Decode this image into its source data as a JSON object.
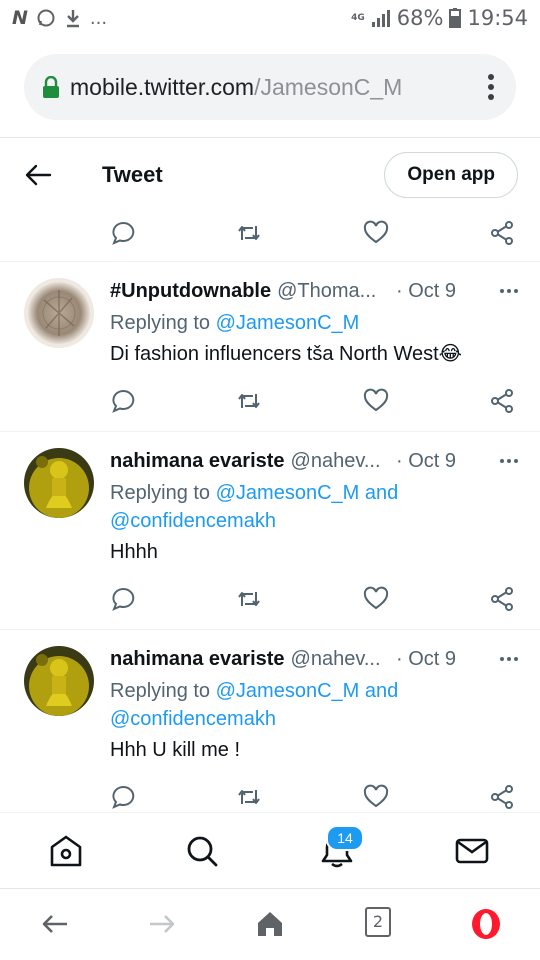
{
  "status_bar": {
    "network": "4G",
    "battery": "68%",
    "time": "19:54",
    "ellipsis": "..."
  },
  "browser": {
    "url_domain": "mobile.twitter.com",
    "url_path": "/JamesonC_M"
  },
  "header": {
    "title": "Tweet",
    "open_app": "Open app"
  },
  "tweets": [
    {
      "name": "#Unputdownable",
      "handle": "@Thoma...",
      "date": "· Oct 9",
      "replying_prefix": "Replying to",
      "replying_to": "@JamesonC_M",
      "replying_and": "",
      "replying_to_2": "",
      "text": "Di fashion influencers tša North West",
      "emoji": "😂"
    },
    {
      "name": "nahimana evariste",
      "handle": "@nahev...",
      "date": "· Oct 9",
      "replying_prefix": "Replying to",
      "replying_to": "@JamesonC_M",
      "replying_and": "and",
      "replying_to_2": "@confidencemakh",
      "text": "Hhhh"
    },
    {
      "name": "nahimana evariste",
      "handle": "@nahev...",
      "date": "· Oct 9",
      "replying_prefix": "Replying to",
      "replying_to": "@JamesonC_M",
      "replying_and": "and",
      "replying_to_2": "@confidencemakh",
      "text": "Hhh U kill me !"
    }
  ],
  "bottom_nav": {
    "notifications_badge": "14",
    "icons": [
      "home-icon",
      "search-icon",
      "notifications-icon",
      "messages-icon"
    ]
  },
  "browser_nav": {
    "tab_count": "2",
    "icons": [
      "back-arrow-icon",
      "forward-arrow-icon",
      "home-icon",
      "tabs-icon",
      "opera-icon"
    ]
  },
  "colors": {
    "accent": "#1d9bf0",
    "text": "#0f1419",
    "secondary": "#536471",
    "opera_red": "#ff1b2d"
  }
}
